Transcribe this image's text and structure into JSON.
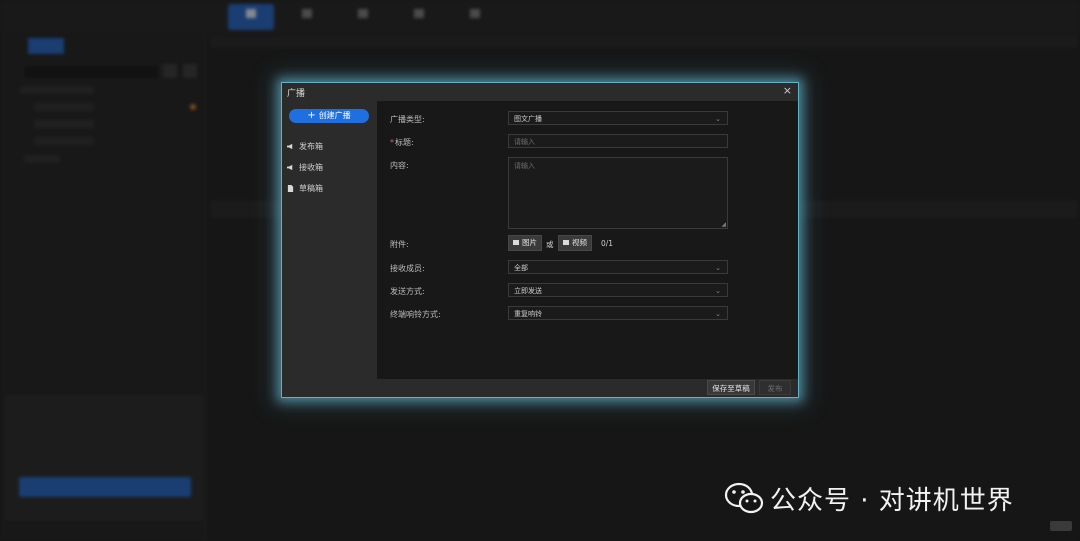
{
  "dialog": {
    "title": "广播",
    "close": "×",
    "sidebar": {
      "create_label": "创建广播",
      "items": [
        {
          "label": "发布箱",
          "icon": "megaphone-icon"
        },
        {
          "label": "接收箱",
          "icon": "megaphone-icon"
        },
        {
          "label": "草稿箱",
          "icon": "document-icon"
        }
      ]
    },
    "form": {
      "broadcast_type_label": "广播类型:",
      "broadcast_type_value": "图文广播",
      "title_label": "标题:",
      "title_placeholder": "请输入",
      "content_label": "内容:",
      "content_placeholder": "请输入",
      "attachment_label": "附件:",
      "image_button": "图片",
      "or_text": "或",
      "video_button": "视频",
      "attachment_count": "0/1",
      "recipients_label": "接收成员:",
      "recipients_value": "全部",
      "send_mode_label": "发送方式:",
      "send_mode_value": "立即发送",
      "ring_mode_label": "终端响铃方式:",
      "ring_mode_value": "重复响铃"
    },
    "footer": {
      "save_draft": "保存至草稿",
      "publish": "发布"
    }
  },
  "watermark": {
    "text": "公众号 · 对讲机世界",
    "icon": "wechat-logo-icon"
  },
  "colors": {
    "accent": "#1f6fe0",
    "dialog_glow": "#5fb3c9"
  }
}
